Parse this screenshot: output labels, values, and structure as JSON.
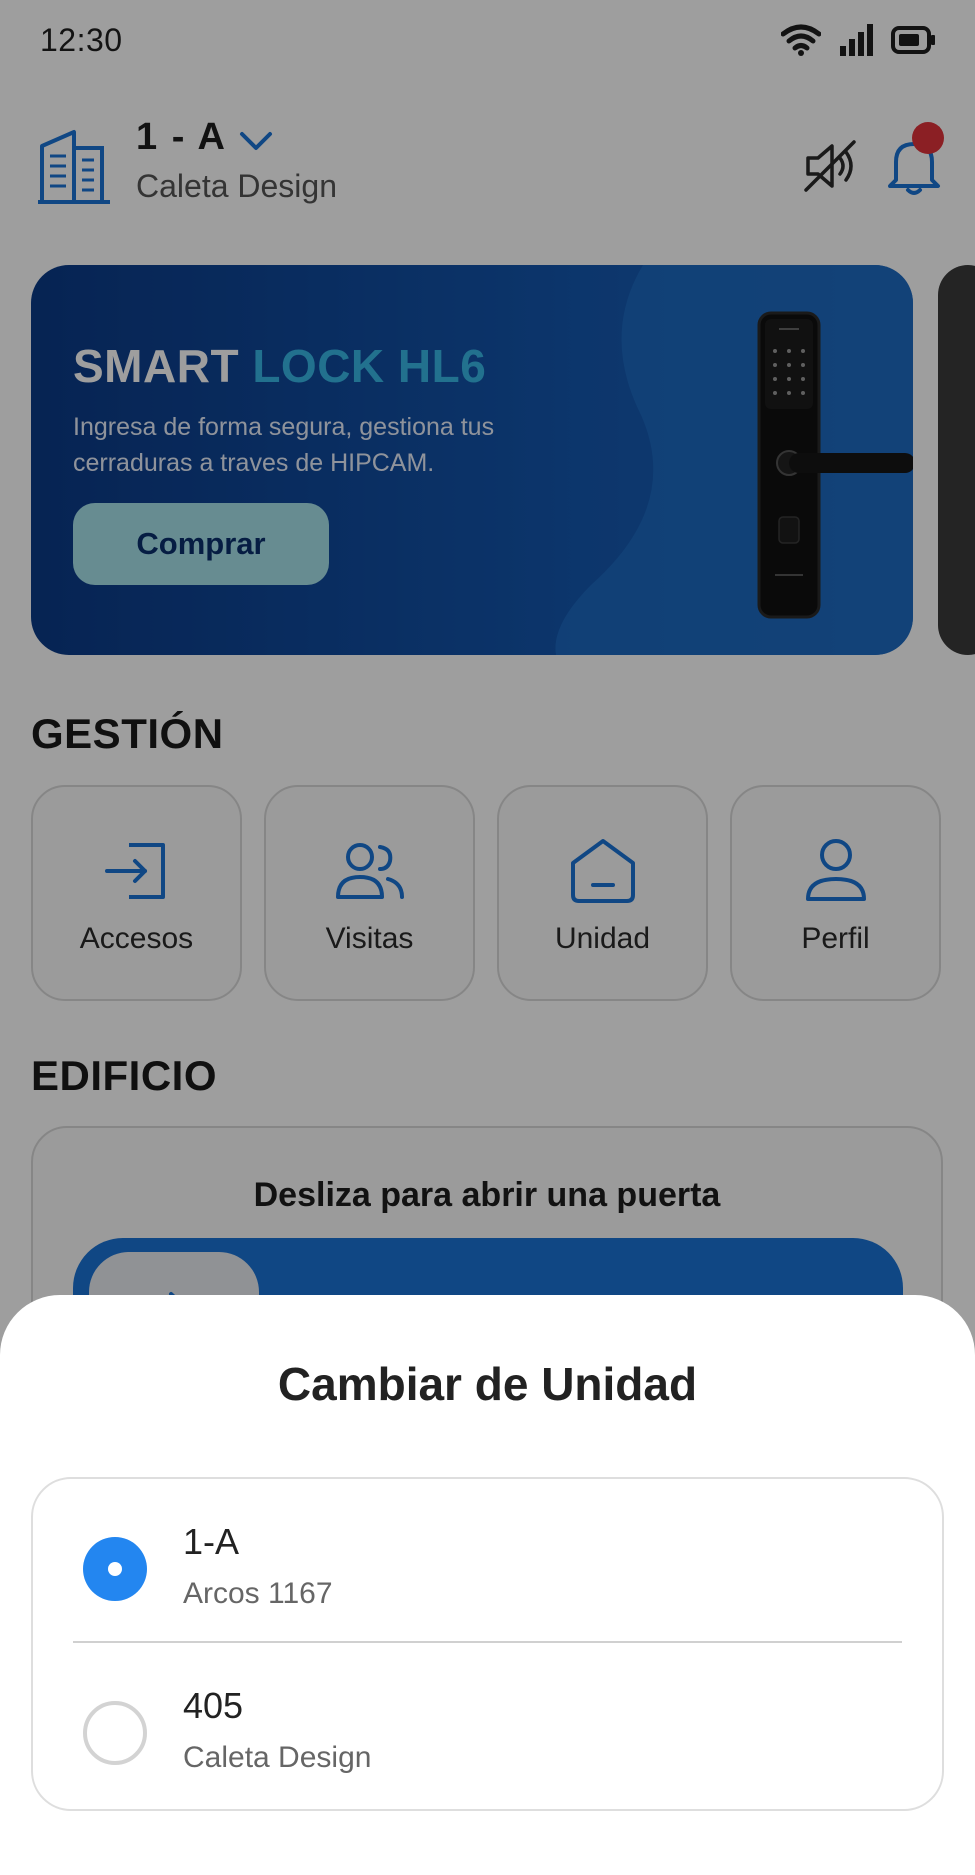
{
  "status_bar": {
    "time": "12:30"
  },
  "header": {
    "unit": "1 - A",
    "building": "Caleta Design"
  },
  "banner": {
    "title_part1": "SMART",
    "title_part2": "LOCK HL6",
    "description": "Ingresa de forma segura, gestiona tus cerraduras a traves de HIPCAM.",
    "button_label": "Comprar",
    "colors": {
      "accent": "#38b6e6",
      "button": "#a7e2ea"
    }
  },
  "gestion": {
    "title": "GESTIÓN",
    "tiles": [
      {
        "label": "Accesos",
        "icon": "login-icon"
      },
      {
        "label": "Visitas",
        "icon": "users-icon"
      },
      {
        "label": "Unidad",
        "icon": "home-icon"
      },
      {
        "label": "Perfil",
        "icon": "user-icon"
      }
    ]
  },
  "edificio": {
    "title": "EDIFICIO",
    "slide_label": "Desliza para abrir una puerta"
  },
  "sheet": {
    "title": "Cambiar de Unidad",
    "options": [
      {
        "unit": "1-A",
        "building": "Arcos 1167",
        "selected": true
      },
      {
        "unit": "405",
        "building": "Caleta Design",
        "selected": false
      }
    ]
  },
  "colors": {
    "primary": "#1a73d6",
    "radio_selected": "#2386f0",
    "notification_dot": "#e0333a"
  }
}
